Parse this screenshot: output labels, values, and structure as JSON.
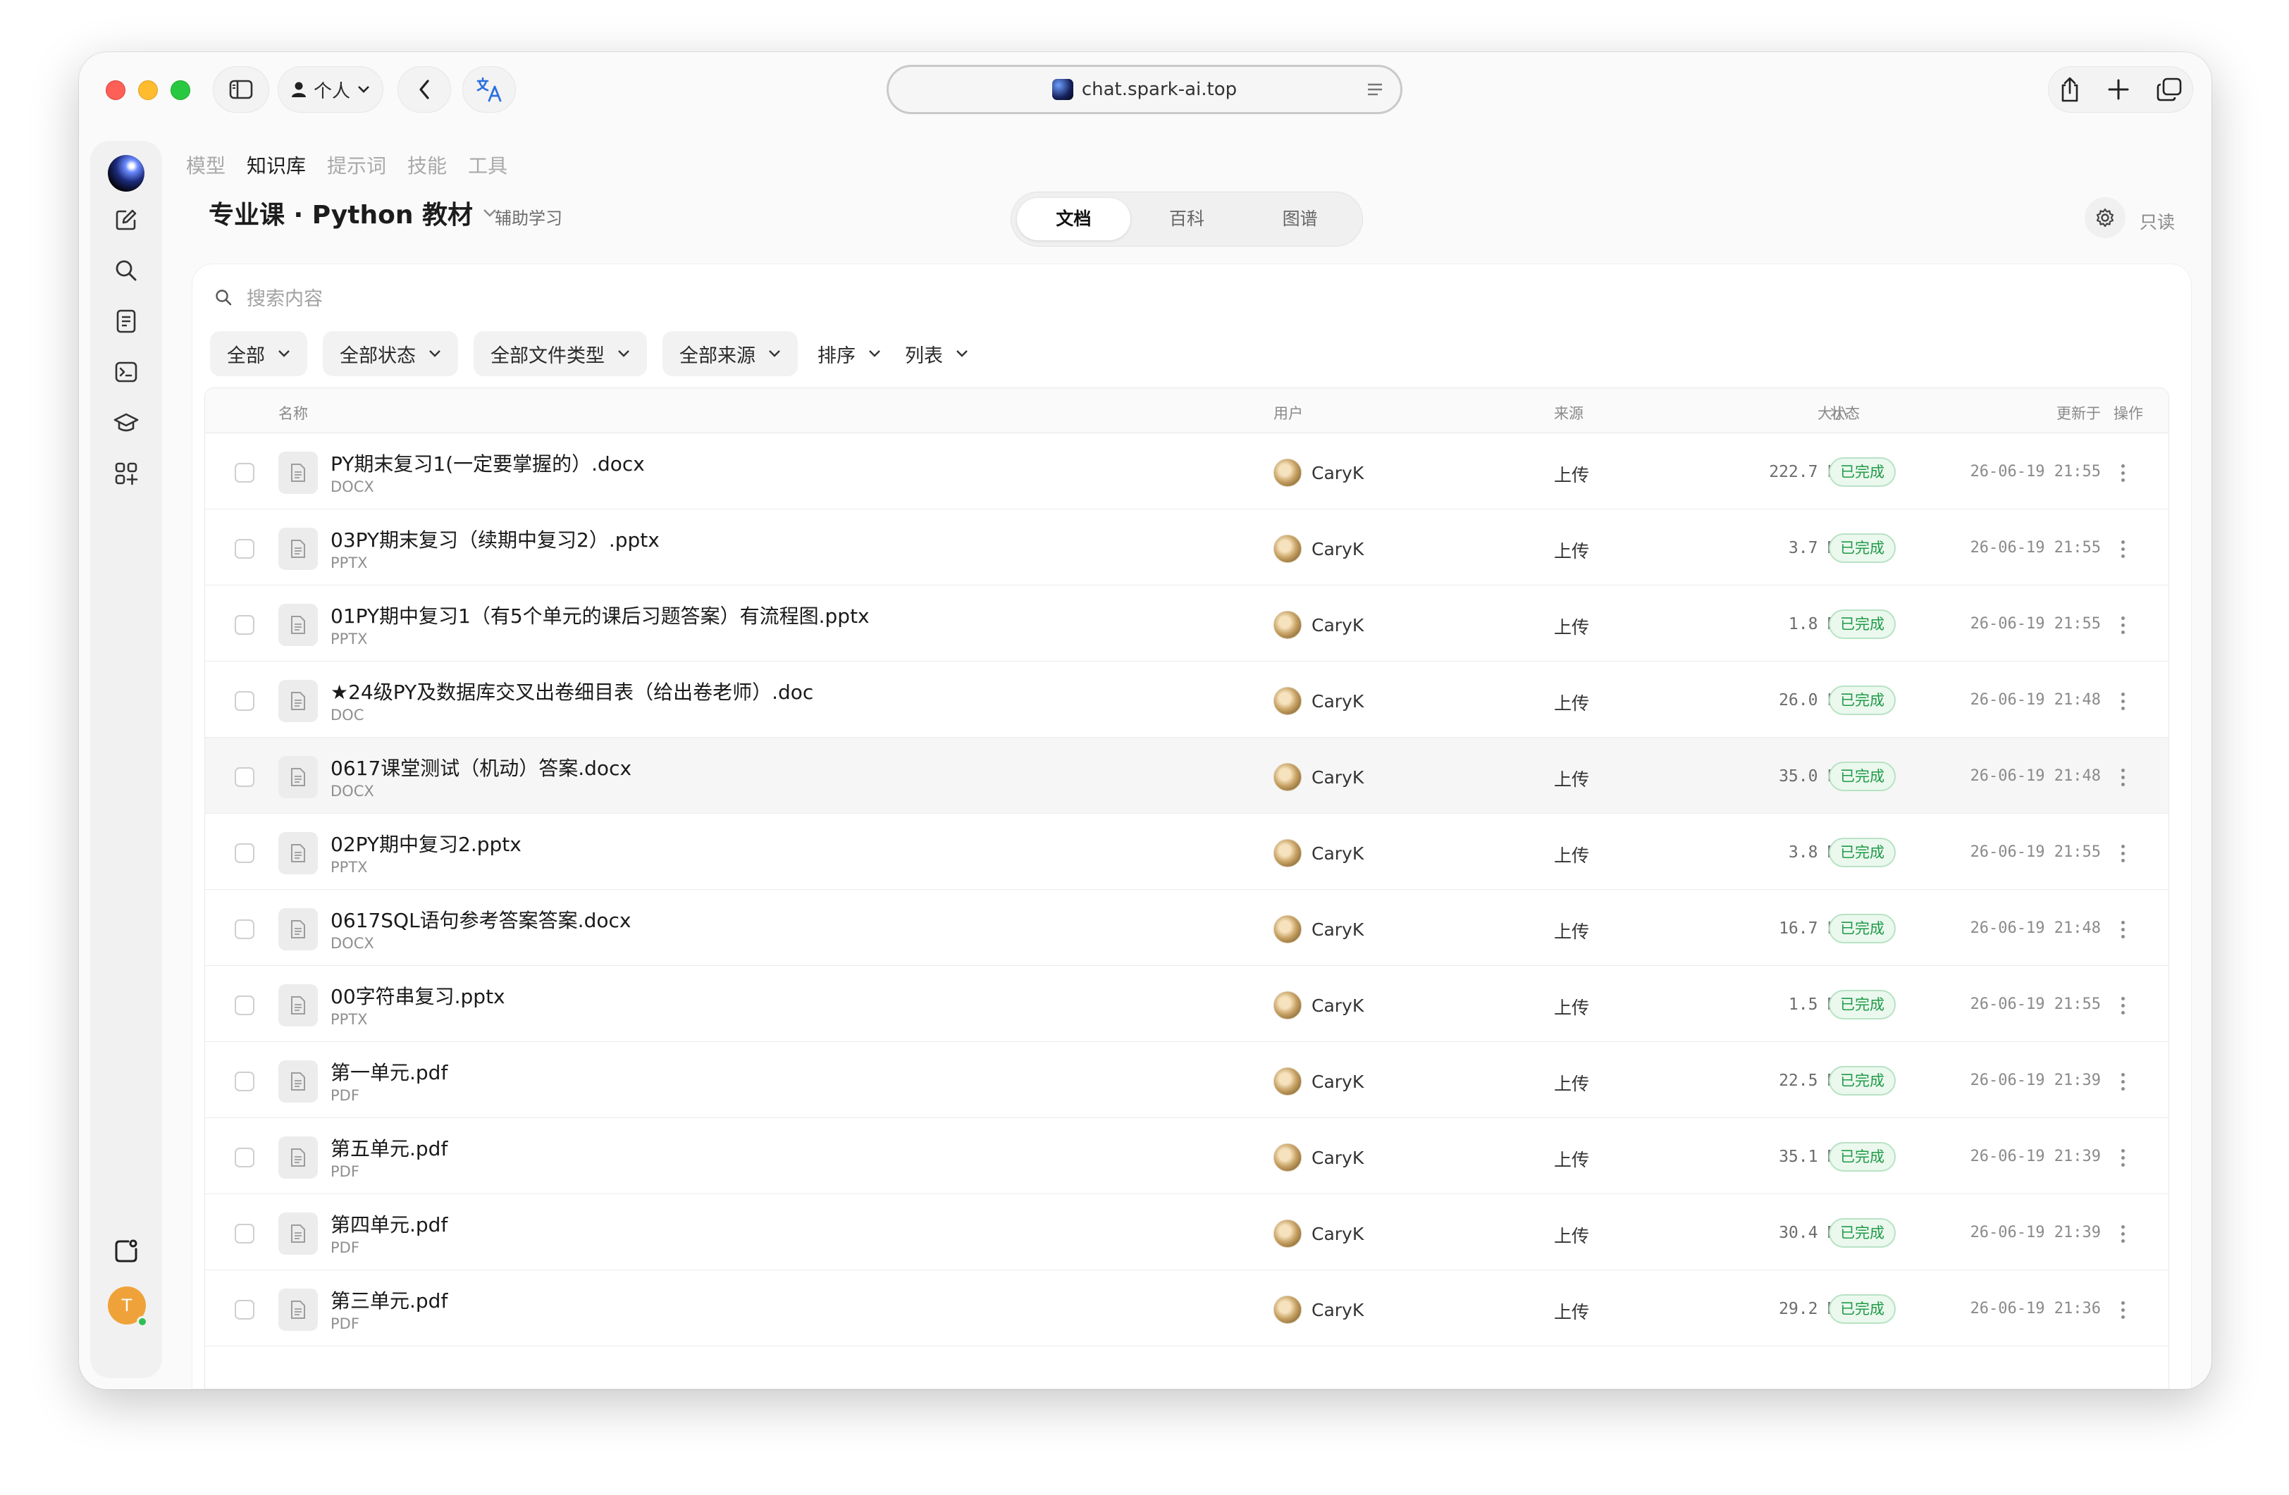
{
  "browser": {
    "profile_label": "个人",
    "url": "chat.spark-ai.top"
  },
  "nav_tabs": [
    "模型",
    "知识库",
    "提示词",
    "技能",
    "工具"
  ],
  "active_nav_tab": "知识库",
  "header": {
    "title": "专业课 · Python 教材",
    "badge": "辅助学习",
    "view_tabs": [
      "文档",
      "百科",
      "图谱"
    ],
    "active_view_tab": "文档",
    "readonly_label": "只读"
  },
  "search": {
    "placeholder": "搜索内容"
  },
  "filters": [
    "全部",
    "全部状态",
    "全部文件类型",
    "全部来源",
    "排序",
    "列表"
  ],
  "table": {
    "columns": {
      "name": "名称",
      "user": "用户",
      "source": "来源",
      "size": "大小",
      "status": "状态",
      "updated": "更新于",
      "actions": "操作"
    },
    "rows": [
      {
        "name": "PY期末复习1(一定要掌握的）.docx",
        "type": "DOCX",
        "user": "CaryK",
        "source": "上传",
        "size": "222.7 KB",
        "status": "已完成",
        "updated": "26-06-19 21:55"
      },
      {
        "name": "03PY期末复习（续期中复习2）.pptx",
        "type": "PPTX",
        "user": "CaryK",
        "source": "上传",
        "size": "3.7 MB",
        "status": "已完成",
        "updated": "26-06-19 21:55"
      },
      {
        "name": "01PY期中复习1（有5个单元的课后习题答案）有流程图.pptx",
        "type": "PPTX",
        "user": "CaryK",
        "source": "上传",
        "size": "1.8 MB",
        "status": "已完成",
        "updated": "26-06-19 21:55"
      },
      {
        "name": "★24级PY及数据库交叉出卷细目表（给出卷老师）.doc",
        "type": "DOC",
        "user": "CaryK",
        "source": "上传",
        "size": "26.0 KB",
        "status": "已完成",
        "updated": "26-06-19 21:48"
      },
      {
        "name": "0617课堂测试（机动）答案.docx",
        "type": "DOCX",
        "user": "CaryK",
        "source": "上传",
        "size": "35.0 KB",
        "status": "已完成",
        "updated": "26-06-19 21:48"
      },
      {
        "name": "02PY期中复习2.pptx",
        "type": "PPTX",
        "user": "CaryK",
        "source": "上传",
        "size": "3.8 MB",
        "status": "已完成",
        "updated": "26-06-19 21:55"
      },
      {
        "name": "0617SQL语句参考答案答案.docx",
        "type": "DOCX",
        "user": "CaryK",
        "source": "上传",
        "size": "16.7 KB",
        "status": "已完成",
        "updated": "26-06-19 21:48"
      },
      {
        "name": "00字符串复习.pptx",
        "type": "PPTX",
        "user": "CaryK",
        "source": "上传",
        "size": "1.5 MB",
        "status": "已完成",
        "updated": "26-06-19 21:55"
      },
      {
        "name": "第一单元.pdf",
        "type": "PDF",
        "user": "CaryK",
        "source": "上传",
        "size": "22.5 MB",
        "status": "已完成",
        "updated": "26-06-19 21:39"
      },
      {
        "name": "第五单元.pdf",
        "type": "PDF",
        "user": "CaryK",
        "source": "上传",
        "size": "35.1 MB",
        "status": "已完成",
        "updated": "26-06-19 21:39"
      },
      {
        "name": "第四单元.pdf",
        "type": "PDF",
        "user": "CaryK",
        "source": "上传",
        "size": "30.4 MB",
        "status": "已完成",
        "updated": "26-06-19 21:39"
      },
      {
        "name": "第三单元.pdf",
        "type": "PDF",
        "user": "CaryK",
        "source": "上传",
        "size": "29.2 MB",
        "status": "已完成",
        "updated": "26-06-19 21:36"
      }
    ]
  },
  "user_avatar_initial": "T",
  "colors": {
    "status_text": "#1f9a47",
    "status_bg": "#ebf8ee",
    "avatar_bg": "#f0a23a",
    "online": "#2fbf55"
  }
}
